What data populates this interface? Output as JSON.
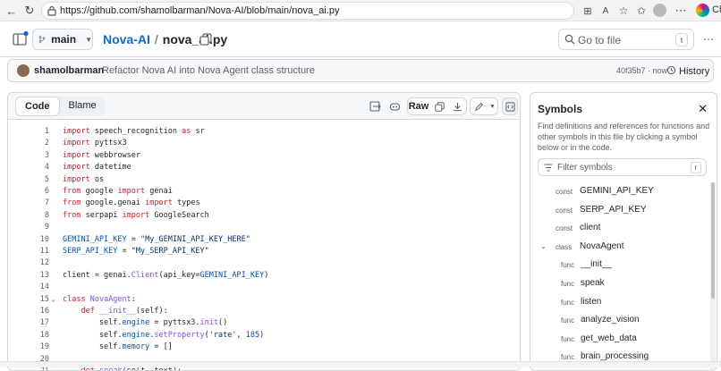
{
  "browser": {
    "url": "https://github.com/shamolbarman/Nova-AI/blob/main/nova_ai.py",
    "profile_text": "Ch"
  },
  "repo": {
    "branch": "main",
    "name": "Nova-AI",
    "separator": "/",
    "file": "nova_ai.py",
    "goto_placeholder": "Go to file",
    "goto_key": "t"
  },
  "commit": {
    "author": "shamolbarman",
    "message": "Refactor Nova AI into Nova Agent class structure",
    "hash_time": "40f35b7 · now",
    "history_label": "History"
  },
  "code": {
    "tabs": [
      "Code",
      "Blame"
    ],
    "raw_label": "Raw",
    "lines": [
      {
        "n": "1",
        "fold": "",
        "html": "<span class='kw'>import</span> speech_recognition <span class='kw'>as</span> sr"
      },
      {
        "n": "2",
        "fold": "",
        "html": "<span class='kw'>import</span> pyttsx3"
      },
      {
        "n": "3",
        "fold": "",
        "html": "<span class='kw'>import</span> webbrowser"
      },
      {
        "n": "4",
        "fold": "",
        "html": "<span class='kw'>import</span> datetime"
      },
      {
        "n": "5",
        "fold": "",
        "html": "<span class='kw'>import</span> os"
      },
      {
        "n": "6",
        "fold": "",
        "html": "<span class='kw'>from</span> google <span class='kw'>import</span> genai"
      },
      {
        "n": "7",
        "fold": "",
        "html": "<span class='kw'>from</span> google.genai <span class='kw'>import</span> types"
      },
      {
        "n": "8",
        "fold": "",
        "html": "<span class='kw'>from</span> serpapi <span class='kw'>import</span> GoogleSearch"
      },
      {
        "n": "9",
        "fold": "",
        "html": ""
      },
      {
        "n": "10",
        "fold": "",
        "html": "<span class='cn'>GEMINI_API_KEY</span> = <span class='str'>\"My_GEMINI_API_KEY_HERE\"</span>"
      },
      {
        "n": "11",
        "fold": "",
        "html": "<span class='cn'>SERP_API_KEY</span> = <span class='str'>\"My_SERP_API_KEY\"</span>"
      },
      {
        "n": "12",
        "fold": "",
        "html": ""
      },
      {
        "n": "13",
        "fold": "",
        "html": "client = genai.<span class='fn'>Client</span>(api_key=<span class='cn'>GEMINI_API_KEY</span>)"
      },
      {
        "n": "14",
        "fold": "",
        "html": ""
      },
      {
        "n": "15",
        "fold": "⌄",
        "html": "<span class='kw'>class</span> <span class='fn'>NovaAgent</span>:"
      },
      {
        "n": "16",
        "fold": "",
        "html": "    <span class='kw'>def</span> <span class='fn'>__init__</span>(self):"
      },
      {
        "n": "17",
        "fold": "",
        "html": "        self.<span class='cn'>engine</span> = pyttsx3.<span class='fn'>init</span>()"
      },
      {
        "n": "18",
        "fold": "",
        "html": "        self.<span class='cn'>engine</span>.<span class='fn'>setProperty</span>(<span class='str'>'rate'</span>, <span class='cn'>185</span>)"
      },
      {
        "n": "19",
        "fold": "",
        "html": "        self.<span class='cn'>memory</span> = []"
      },
      {
        "n": "20",
        "fold": "",
        "html": ""
      },
      {
        "n": "21",
        "fold": "",
        "html": "    <span class='kw'>def</span> <span class='fn'>speak</span>(self, text):"
      }
    ]
  },
  "symbols": {
    "title": "Symbols",
    "description": "Find definitions and references for functions and other symbols in this file by clicking a symbol below or in the code.",
    "filter_placeholder": "Filter symbols",
    "filter_key": "r",
    "items": [
      {
        "kind": "const",
        "name": "GEMINI_API_KEY",
        "indent": 0,
        "chevron": ""
      },
      {
        "kind": "const",
        "name": "SERP_API_KEY",
        "indent": 0,
        "chevron": ""
      },
      {
        "kind": "const",
        "name": "client",
        "indent": 0,
        "chevron": ""
      },
      {
        "kind": "class",
        "name": "NovaAgent",
        "indent": 0,
        "chevron": "⌄"
      },
      {
        "kind": "func",
        "name": "__init__",
        "indent": 1,
        "chevron": ""
      },
      {
        "kind": "func",
        "name": "speak",
        "indent": 1,
        "chevron": ""
      },
      {
        "kind": "func",
        "name": "listen",
        "indent": 1,
        "chevron": ""
      },
      {
        "kind": "func",
        "name": "analyze_vision",
        "indent": 1,
        "chevron": ""
      },
      {
        "kind": "func",
        "name": "get_web_data",
        "indent": 1,
        "chevron": ""
      },
      {
        "kind": "func",
        "name": "brain_processing",
        "indent": 1,
        "chevron": ""
      }
    ]
  }
}
